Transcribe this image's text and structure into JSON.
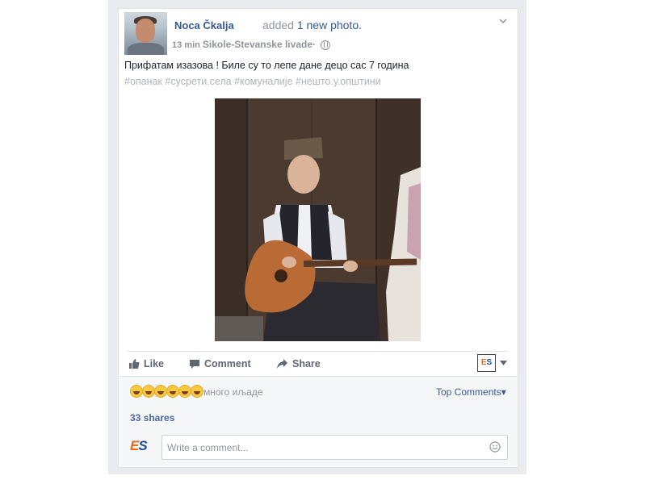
{
  "post": {
    "author": "Noca Čkalja",
    "action_prefix": "added",
    "action_link": "1 new photo.",
    "time": "13 min",
    "location": "Sikole-Stevanske livade·",
    "text": "Прифатам изазова ! Биле су то лепе дане децо сас 7 година",
    "hashtags": "#опанак #сусрети.села #комуналије #нешто.у.општини"
  },
  "actions": {
    "like": "Like",
    "comment": "Comment",
    "share": "Share",
    "badge": "ES"
  },
  "reactions": {
    "count_emojis": 6,
    "label": "много иљаде",
    "top_comments": "Top Comments"
  },
  "shares": "33 shares",
  "comment_box": {
    "logo": "ES",
    "placeholder": "Write a comment..."
  },
  "icons": [
    "globe-icon",
    "chevron-down-icon",
    "like-icon",
    "comment-icon",
    "share-icon",
    "smile-icon",
    "haha-emoji-icon"
  ],
  "colors": {
    "link": "#365899",
    "muted": "#90949c",
    "background": "#e9ebee",
    "brand_orange": "#e86a17",
    "brand_blue": "#1c4e9a"
  }
}
